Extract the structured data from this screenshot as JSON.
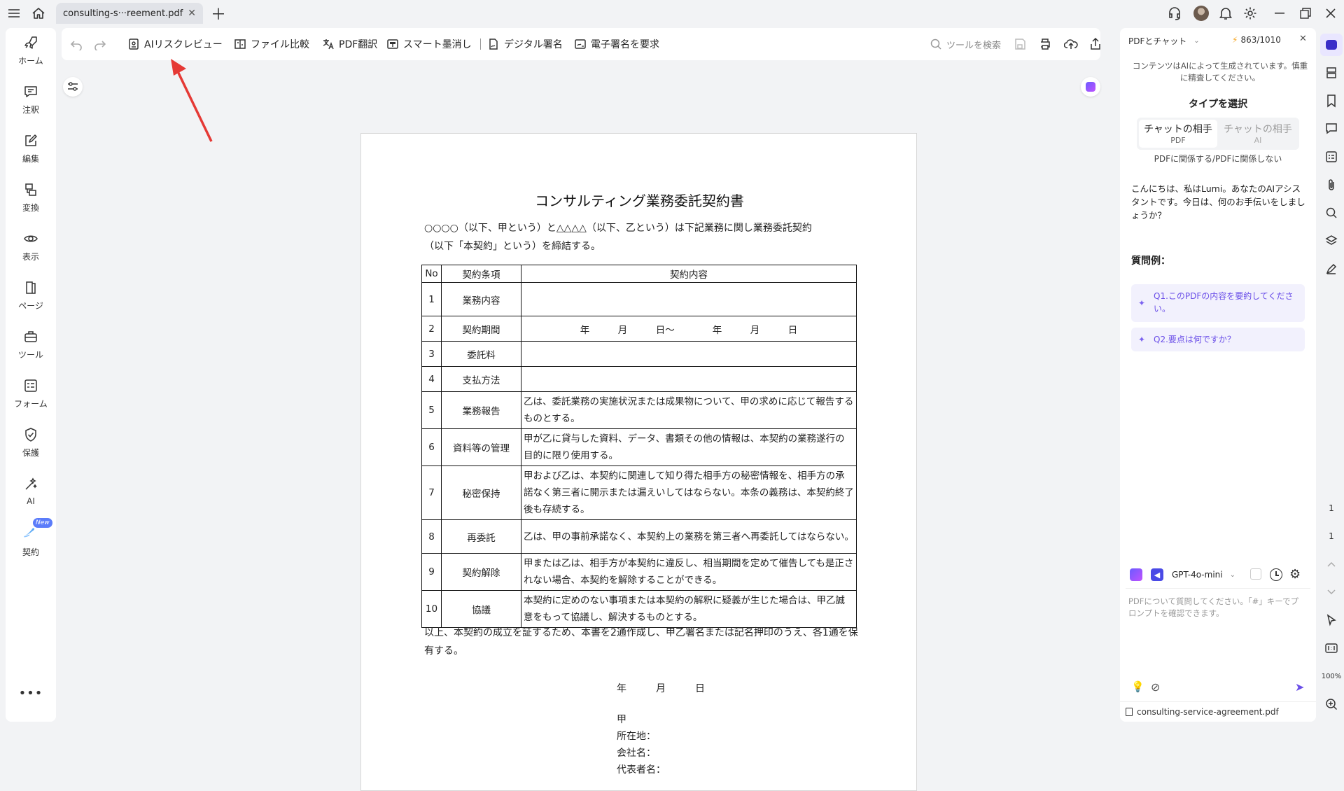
{
  "titlebar": {
    "tab_title": "consulting-s···reement.pdf"
  },
  "left_nav": [
    {
      "label": "ホーム",
      "icon": "rocket-icon"
    },
    {
      "label": "注釈",
      "icon": "comment-icon"
    },
    {
      "label": "編集",
      "icon": "edit-icon"
    },
    {
      "label": "変換",
      "icon": "convert-icon"
    },
    {
      "label": "表示",
      "icon": "eye-icon"
    },
    {
      "label": "ページ",
      "icon": "page-icon"
    },
    {
      "label": "ツール",
      "icon": "toolbox-icon"
    },
    {
      "label": "フォーム",
      "icon": "form-icon"
    },
    {
      "label": "保護",
      "icon": "shield-icon"
    },
    {
      "label": "AI",
      "icon": "ai-wand-icon"
    },
    {
      "label": "契約",
      "icon": "contract-icon",
      "badge": "New"
    }
  ],
  "toolbar": {
    "ai_risk_review": "AIリスクレビュー",
    "file_compare": "ファイル比較",
    "pdf_translate": "PDF翻訳",
    "smart_redact": "スマート墨消し",
    "digital_sign": "デジタル署名",
    "request_esign": "電子署名を要求",
    "search_placeholder": "ツールを検索"
  },
  "document": {
    "title": "コンサルティング業務委託契約書",
    "intro_1": "○○○○（以下、甲という）と△△△△（以下、乙という）は下記業務に関し業務委託契約",
    "intro_2": "（以下「本契約」という）を締結する。",
    "table_headers": [
      "No",
      "契約条項",
      "契約内容"
    ],
    "rows": [
      {
        "no": "1",
        "item": "業務内容",
        "content": ""
      },
      {
        "no": "2",
        "item": "契約期間",
        "content": "年　　　月　　　日～　　　　年　　　月　　　日"
      },
      {
        "no": "3",
        "item": "委託料",
        "content": ""
      },
      {
        "no": "4",
        "item": "支払方法",
        "content": ""
      },
      {
        "no": "5",
        "item": "業務報告",
        "content": "乙は、委託業務の実施状況または成果物について、甲の求めに応じて報告するものとする。"
      },
      {
        "no": "6",
        "item": "資料等の管理",
        "content": "甲が乙に貸与した資料、データ、書類その他の情報は、本契約の業務遂行の目的に限り使用する。"
      },
      {
        "no": "7",
        "item": "秘密保持",
        "content": "甲および乙は、本契約に関連して知り得た相手方の秘密情報を、相手方の承諾なく第三者に開示または漏えいしてはならない。本条の義務は、本契約終了後も存続する。"
      },
      {
        "no": "8",
        "item": "再委託",
        "content": "乙は、甲の事前承諾なく、本契約上の業務を第三者へ再委託してはならない。"
      },
      {
        "no": "9",
        "item": "契約解除",
        "content": "甲または乙は、相手方が本契約に違反し、相当期間を定めて催告しても是正されない場合、本契約を解除することができる。"
      },
      {
        "no": "10",
        "item": "協議",
        "content": "本契約に定めのない事項または本契約の解釈に疑義が生じた場合は、甲乙誠意をもって協議し、解決するものとする。"
      }
    ],
    "closing": "以上、本契約の成立を証するため、本書を2通作成し、甲乙署名または記名押印のうえ、各1通を保有する。",
    "date_line": "年　　　月　　　日",
    "party": "甲",
    "address": "所在地：",
    "company": "会社名：",
    "representative": "代表者名："
  },
  "chat": {
    "mode_select": "PDFとチャット",
    "credits": "863/1010",
    "disclaimer": "コンテンツはAIによって生成されています。慎重に精査してください。",
    "type_heading": "タイプを選択",
    "type_pdf_label": "チャットの相手",
    "type_pdf_sub": "PDF",
    "type_ai_label": "チャットの相手",
    "type_ai_sub": "AI",
    "type_caption": "PDFに関係する/PDFに関係しない",
    "greeting": "こんにちは、私はLumi。あなたのAIアシスタントです。今日は、何のお手伝いをしましょうか？",
    "examples_heading": "質問例：",
    "example_1": "Q1.このPDFの内容を要約してください。",
    "example_2": "Q2.要点は何ですか？",
    "model": "GPT-4o-mini",
    "input_placeholder": "PDFについて質問してください。「#」キーでプロンプトを確認できます。",
    "file_name": "consulting-service-agreement.pdf"
  },
  "page_nav": {
    "current": "1",
    "total": "1",
    "zoom": "100%"
  }
}
